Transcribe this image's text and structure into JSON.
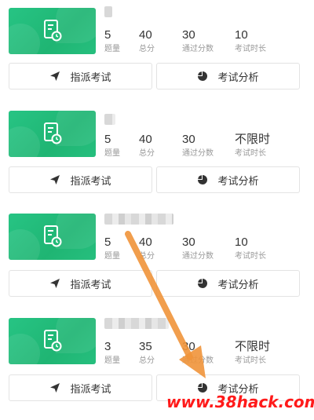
{
  "exams": [
    {
      "stats": [
        {
          "value": "5",
          "label": "题量"
        },
        {
          "value": "40",
          "label": "总分"
        },
        {
          "value": "30",
          "label": "通过分数"
        },
        {
          "value": "10",
          "label": "考试时长"
        }
      ],
      "assign_label": "指派考试",
      "analysis_label": "考试分析"
    },
    {
      "stats": [
        {
          "value": "5",
          "label": "题量"
        },
        {
          "value": "40",
          "label": "总分"
        },
        {
          "value": "30",
          "label": "通过分数"
        },
        {
          "value": "不限时",
          "label": "考试时长"
        }
      ],
      "assign_label": "指派考试",
      "analysis_label": "考试分析"
    },
    {
      "stats": [
        {
          "value": "5",
          "label": "题量"
        },
        {
          "value": "40",
          "label": "总分"
        },
        {
          "value": "30",
          "label": "通过分数"
        },
        {
          "value": "10",
          "label": "考试时长"
        }
      ],
      "assign_label": "指派考试",
      "analysis_label": "考试分析"
    },
    {
      "stats": [
        {
          "value": "3",
          "label": "题量"
        },
        {
          "value": "35",
          "label": "总分"
        },
        {
          "value": "30",
          "label": "通过分数"
        },
        {
          "value": "不限时",
          "label": "考试时长"
        }
      ],
      "assign_label": "指派考试",
      "analysis_label": "考试分析"
    }
  ],
  "watermark": "www.38hack.com",
  "colors": {
    "accent": "#1fb573",
    "arrow": "#f0943a",
    "watermark": "#ff1a1a"
  },
  "icons": {
    "thumb": "exam-doc-clock-icon",
    "assign": "send-plane-icon",
    "analysis": "pie-chart-icon"
  }
}
